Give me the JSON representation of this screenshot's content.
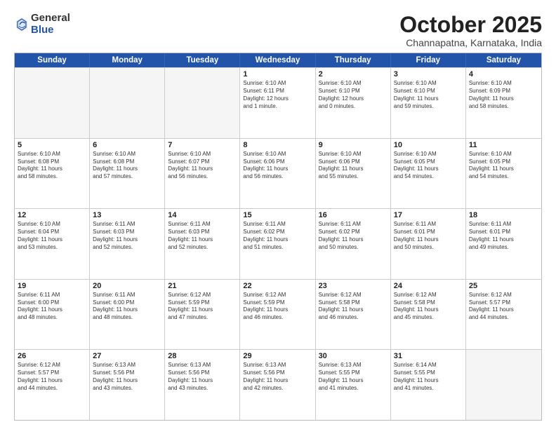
{
  "logo": {
    "general": "General",
    "blue": "Blue"
  },
  "header": {
    "title": "October 2025",
    "subtitle": "Channapatna, Karnataka, India"
  },
  "weekdays": [
    "Sunday",
    "Monday",
    "Tuesday",
    "Wednesday",
    "Thursday",
    "Friday",
    "Saturday"
  ],
  "weeks": [
    [
      {
        "day": "",
        "info": ""
      },
      {
        "day": "",
        "info": ""
      },
      {
        "day": "",
        "info": ""
      },
      {
        "day": "1",
        "info": "Sunrise: 6:10 AM\nSunset: 6:11 PM\nDaylight: 12 hours\nand 1 minute."
      },
      {
        "day": "2",
        "info": "Sunrise: 6:10 AM\nSunset: 6:10 PM\nDaylight: 12 hours\nand 0 minutes."
      },
      {
        "day": "3",
        "info": "Sunrise: 6:10 AM\nSunset: 6:10 PM\nDaylight: 11 hours\nand 59 minutes."
      },
      {
        "day": "4",
        "info": "Sunrise: 6:10 AM\nSunset: 6:09 PM\nDaylight: 11 hours\nand 58 minutes."
      }
    ],
    [
      {
        "day": "5",
        "info": "Sunrise: 6:10 AM\nSunset: 6:08 PM\nDaylight: 11 hours\nand 58 minutes."
      },
      {
        "day": "6",
        "info": "Sunrise: 6:10 AM\nSunset: 6:08 PM\nDaylight: 11 hours\nand 57 minutes."
      },
      {
        "day": "7",
        "info": "Sunrise: 6:10 AM\nSunset: 6:07 PM\nDaylight: 11 hours\nand 56 minutes."
      },
      {
        "day": "8",
        "info": "Sunrise: 6:10 AM\nSunset: 6:06 PM\nDaylight: 11 hours\nand 56 minutes."
      },
      {
        "day": "9",
        "info": "Sunrise: 6:10 AM\nSunset: 6:06 PM\nDaylight: 11 hours\nand 55 minutes."
      },
      {
        "day": "10",
        "info": "Sunrise: 6:10 AM\nSunset: 6:05 PM\nDaylight: 11 hours\nand 54 minutes."
      },
      {
        "day": "11",
        "info": "Sunrise: 6:10 AM\nSunset: 6:05 PM\nDaylight: 11 hours\nand 54 minutes."
      }
    ],
    [
      {
        "day": "12",
        "info": "Sunrise: 6:10 AM\nSunset: 6:04 PM\nDaylight: 11 hours\nand 53 minutes."
      },
      {
        "day": "13",
        "info": "Sunrise: 6:11 AM\nSunset: 6:03 PM\nDaylight: 11 hours\nand 52 minutes."
      },
      {
        "day": "14",
        "info": "Sunrise: 6:11 AM\nSunset: 6:03 PM\nDaylight: 11 hours\nand 52 minutes."
      },
      {
        "day": "15",
        "info": "Sunrise: 6:11 AM\nSunset: 6:02 PM\nDaylight: 11 hours\nand 51 minutes."
      },
      {
        "day": "16",
        "info": "Sunrise: 6:11 AM\nSunset: 6:02 PM\nDaylight: 11 hours\nand 50 minutes."
      },
      {
        "day": "17",
        "info": "Sunrise: 6:11 AM\nSunset: 6:01 PM\nDaylight: 11 hours\nand 50 minutes."
      },
      {
        "day": "18",
        "info": "Sunrise: 6:11 AM\nSunset: 6:01 PM\nDaylight: 11 hours\nand 49 minutes."
      }
    ],
    [
      {
        "day": "19",
        "info": "Sunrise: 6:11 AM\nSunset: 6:00 PM\nDaylight: 11 hours\nand 48 minutes."
      },
      {
        "day": "20",
        "info": "Sunrise: 6:11 AM\nSunset: 6:00 PM\nDaylight: 11 hours\nand 48 minutes."
      },
      {
        "day": "21",
        "info": "Sunrise: 6:12 AM\nSunset: 5:59 PM\nDaylight: 11 hours\nand 47 minutes."
      },
      {
        "day": "22",
        "info": "Sunrise: 6:12 AM\nSunset: 5:59 PM\nDaylight: 11 hours\nand 46 minutes."
      },
      {
        "day": "23",
        "info": "Sunrise: 6:12 AM\nSunset: 5:58 PM\nDaylight: 11 hours\nand 46 minutes."
      },
      {
        "day": "24",
        "info": "Sunrise: 6:12 AM\nSunset: 5:58 PM\nDaylight: 11 hours\nand 45 minutes."
      },
      {
        "day": "25",
        "info": "Sunrise: 6:12 AM\nSunset: 5:57 PM\nDaylight: 11 hours\nand 44 minutes."
      }
    ],
    [
      {
        "day": "26",
        "info": "Sunrise: 6:12 AM\nSunset: 5:57 PM\nDaylight: 11 hours\nand 44 minutes."
      },
      {
        "day": "27",
        "info": "Sunrise: 6:13 AM\nSunset: 5:56 PM\nDaylight: 11 hours\nand 43 minutes."
      },
      {
        "day": "28",
        "info": "Sunrise: 6:13 AM\nSunset: 5:56 PM\nDaylight: 11 hours\nand 43 minutes."
      },
      {
        "day": "29",
        "info": "Sunrise: 6:13 AM\nSunset: 5:56 PM\nDaylight: 11 hours\nand 42 minutes."
      },
      {
        "day": "30",
        "info": "Sunrise: 6:13 AM\nSunset: 5:55 PM\nDaylight: 11 hours\nand 41 minutes."
      },
      {
        "day": "31",
        "info": "Sunrise: 6:14 AM\nSunset: 5:55 PM\nDaylight: 11 hours\nand 41 minutes."
      },
      {
        "day": "",
        "info": ""
      }
    ]
  ]
}
